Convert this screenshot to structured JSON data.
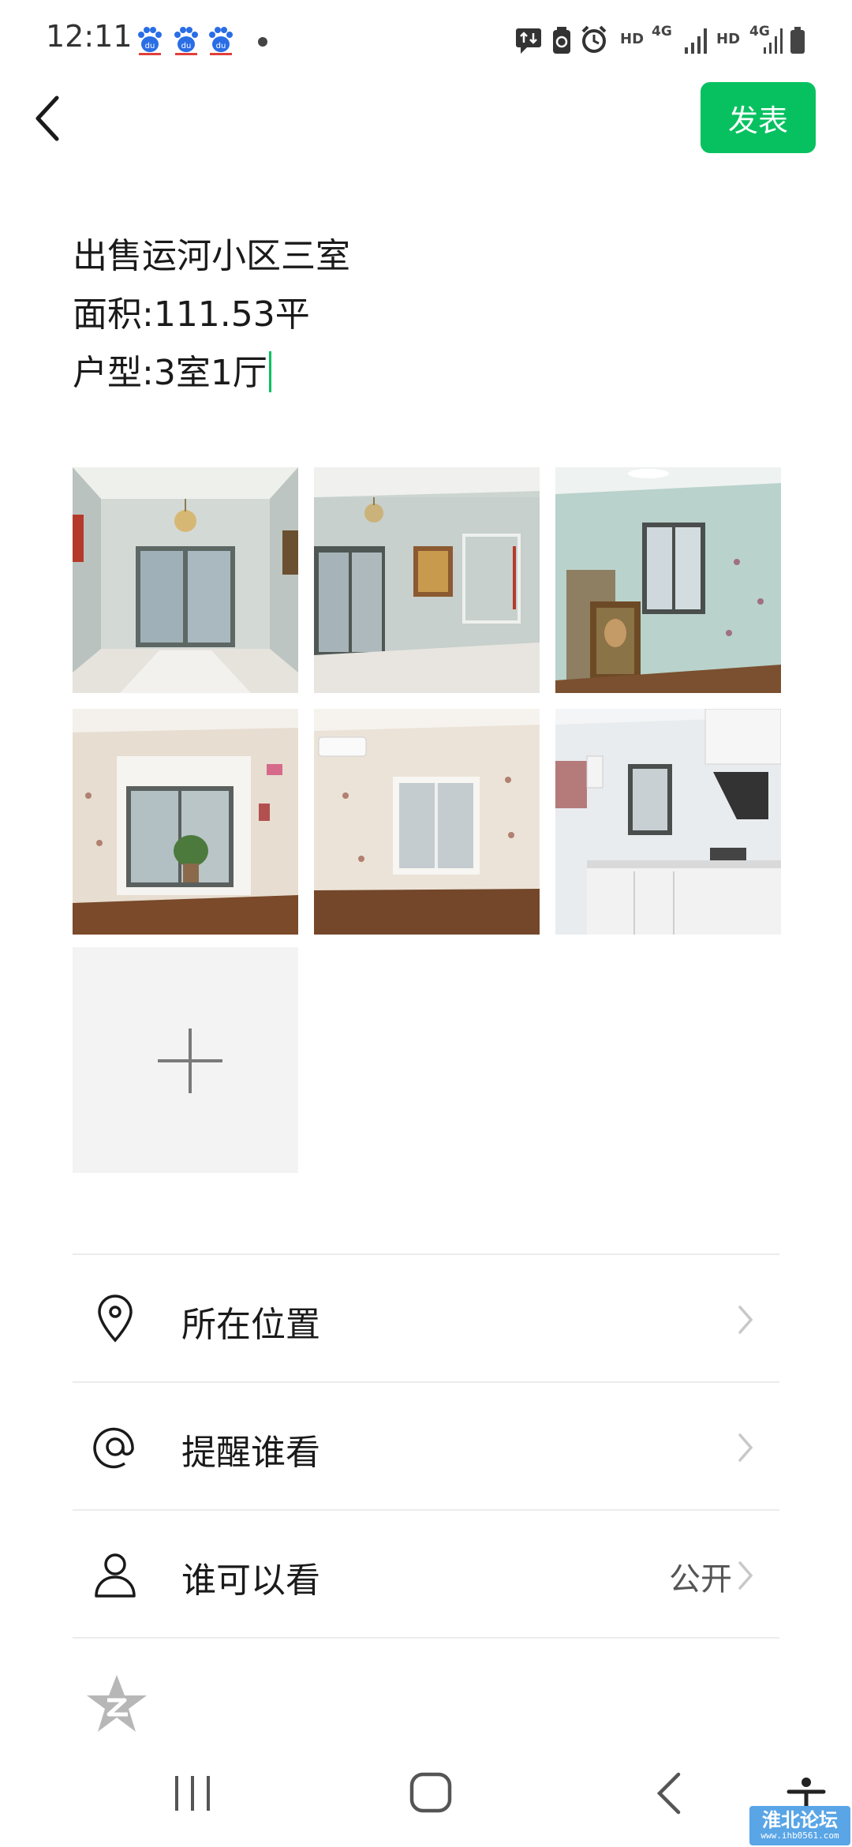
{
  "status_bar": {
    "time": "12:11",
    "left_icons": [
      "baidu-icon",
      "baidu-icon",
      "baidu-icon",
      "dot-icon"
    ],
    "right_icons": [
      "message-sync-icon",
      "battery-saver-icon",
      "alarm-icon",
      "hd-signal-icon",
      "4g-signal-icon",
      "hd-signal-icon",
      "4g-signal-icon",
      "battery-icon"
    ],
    "hd_label": "HD",
    "network_label": "4G"
  },
  "header": {
    "back_icon": "chevron-left-icon",
    "publish_label": "发表",
    "accent_color": "#07c160"
  },
  "post": {
    "lines": [
      "出售运河小区三室",
      "面积:111.53平",
      "户型:3室1厅"
    ]
  },
  "photos": [
    {
      "scene": "living room with chandelier"
    },
    {
      "scene": "living room with paintings"
    },
    {
      "scene": "bedroom with window and framed paintings"
    },
    {
      "scene": "room with balcony and plant"
    },
    {
      "scene": "bedroom with window and air conditioner"
    },
    {
      "scene": "kitchen"
    }
  ],
  "add_photo_icon": "plus-icon",
  "options": [
    {
      "icon": "location-pin-icon",
      "label": "所在位置",
      "value": ""
    },
    {
      "icon": "at-sign-icon",
      "label": "提醒谁看",
      "value": ""
    },
    {
      "icon": "person-icon",
      "label": "谁可以看",
      "value": "公开"
    }
  ],
  "share_icon": "qzone-star-icon",
  "nav_bar": {
    "icons": [
      "recents-icon",
      "home-icon",
      "back-icon",
      "accessibility-icon"
    ]
  },
  "watermark": {
    "title": "淮北论坛",
    "url": "www.ihb0561.com"
  }
}
